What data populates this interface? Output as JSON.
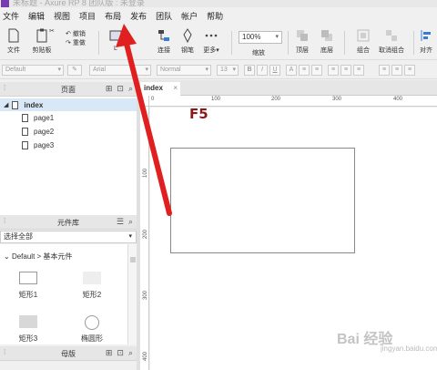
{
  "titlebar": {
    "text": "未标题 - Axure RP 8 团队版 : 未登录"
  },
  "menu": [
    "文件",
    "编辑",
    "视图",
    "项目",
    "布局",
    "发布",
    "团队",
    "帐户",
    "帮助"
  ],
  "toolbar": {
    "file_label": "文件",
    "clipboard_label": "剪贴板",
    "cut_label": "✂",
    "undo_label": "撤销",
    "redo_label": "重做",
    "select_label": "L",
    "connect_label": "连接",
    "pen_label": "钢笔",
    "more_label": "更多▾",
    "zoom_value": "100%",
    "zoom_label": "缩放",
    "top_label": "顶层",
    "bottom_label": "底层",
    "group_label": "组合",
    "ungroup_label": "取消组合",
    "align_label": "对齐"
  },
  "format": {
    "style": "Default",
    "font": "Arial",
    "weight": "Normal",
    "size": "13",
    "bold": "B",
    "italic": "I",
    "underline": "U"
  },
  "pages_panel": {
    "title": "页面",
    "root": "index",
    "children": [
      "page1",
      "page2",
      "page3"
    ]
  },
  "library_panel": {
    "title": "元件库",
    "selected": "选择全部",
    "group": "Default > 基本元件",
    "widgets": [
      "矩形1",
      "矩形2",
      "矩形3",
      "椭圆形"
    ]
  },
  "masters_panel": {
    "title": "母版"
  },
  "canvas": {
    "tab": "index",
    "hruler": [
      "0",
      "100",
      "200",
      "300",
      "400"
    ],
    "vruler": [
      "100",
      "200",
      "300",
      "400"
    ],
    "annotation": "F5"
  },
  "watermark": {
    "text": "Bai 经验",
    "sub": "jingyan.baidu.com"
  },
  "colors": {
    "arrow": "#e02020",
    "annotation": "#8a1a1a",
    "selected_page": "#d9e8f6"
  }
}
